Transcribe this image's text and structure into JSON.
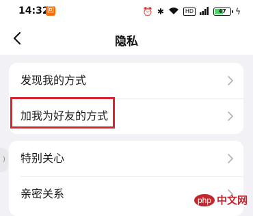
{
  "status_bar": {
    "time": "14:32",
    "app_badge": "回",
    "battery_level": "47",
    "hd_label": "HD"
  },
  "nav": {
    "title": "隐私"
  },
  "settings": {
    "group1": [
      {
        "label": "发现我的方式"
      },
      {
        "label": "加我为好友的方式"
      }
    ],
    "group2": [
      {
        "label": "特别关心"
      },
      {
        "label": "亲密关系"
      }
    ]
  },
  "watermark": {
    "php": "php",
    "site": "中文网"
  },
  "colors": {
    "highlight": "#d9232d",
    "background": "#f2f2f6",
    "card": "#ffffff"
  }
}
